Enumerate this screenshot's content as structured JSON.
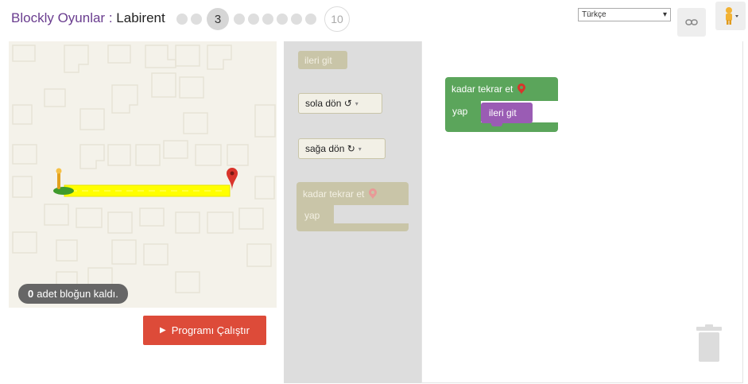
{
  "header": {
    "brand": "Blockly Oyunlar",
    "separator": " : ",
    "game": "Labirent",
    "levels": {
      "current": "3",
      "last": "10",
      "total": 10,
      "current_index": 3
    },
    "language": {
      "selected": "Türkçe"
    },
    "icons": {
      "link": "link-icon",
      "pegman": "pegman-icon"
    }
  },
  "maze": {
    "capacity_count": "0",
    "capacity_text": "adet bloğun kaldı.",
    "run_label": "Programı Çalıştır"
  },
  "toolbox": {
    "blocks": {
      "forward": "ileri git",
      "turn_left": "sola dön ↺",
      "turn_right": "sağa dön ↻",
      "repeat_label": "kadar tekrar et",
      "repeat_do": "yap"
    }
  },
  "workspace": {
    "repeat_label": "kadar tekrar et",
    "repeat_do": "yap",
    "inner_block": "ileri git"
  },
  "colors": {
    "accent_purple": "#6a3d8f",
    "run_button": "#dd4b39",
    "loop_green": "#5ba55b",
    "move_purple": "#9a5cb4",
    "disabled_block": "#c9c5a8",
    "path_yellow": "#ffff00"
  }
}
